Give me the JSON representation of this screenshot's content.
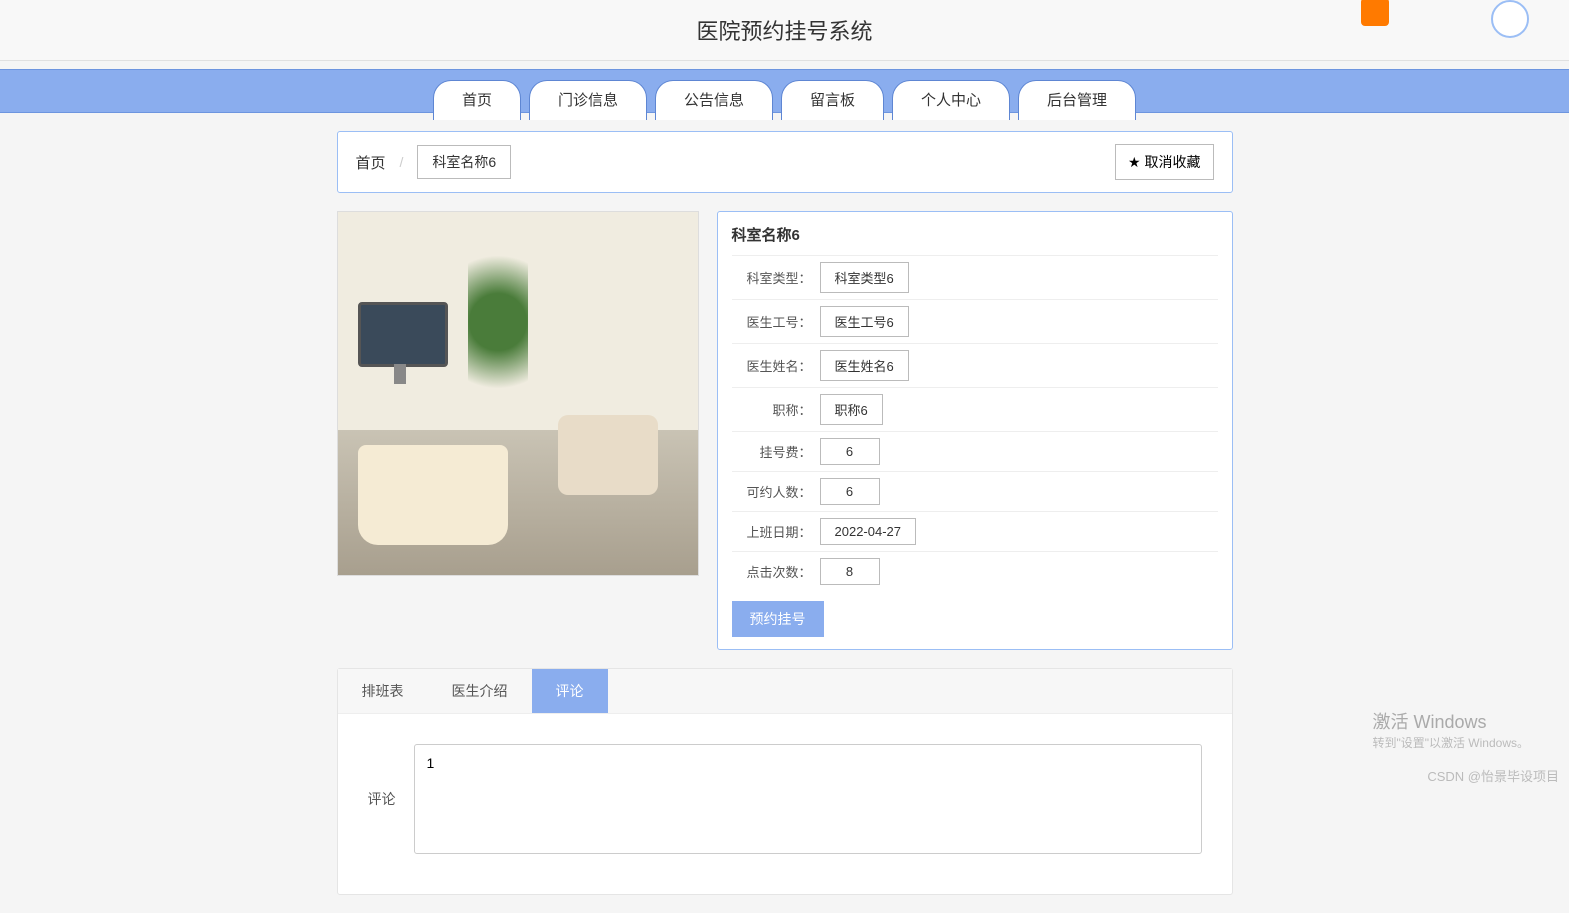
{
  "header": {
    "title": "医院预约挂号系统"
  },
  "nav": {
    "items": [
      "首页",
      "门诊信息",
      "公告信息",
      "留言板",
      "个人中心",
      "后台管理"
    ]
  },
  "breadcrumb": {
    "home": "首页",
    "separator": "/",
    "current": "科室名称6",
    "cancel_fav": "取消收藏",
    "star": "★"
  },
  "detail": {
    "title": "科室名称6",
    "rows": [
      {
        "label": "科室类型：",
        "value": "科室类型6"
      },
      {
        "label": "医生工号：",
        "value": "医生工号6"
      },
      {
        "label": "医生姓名：",
        "value": "医生姓名6"
      },
      {
        "label": "职称：",
        "value": "职称6"
      },
      {
        "label": "挂号费：",
        "value": "6"
      },
      {
        "label": "可约人数：",
        "value": "6"
      },
      {
        "label": "上班日期：",
        "value": "2022-04-27"
      },
      {
        "label": "点击次数：",
        "value": "8"
      }
    ],
    "reserve_btn": "预约挂号"
  },
  "sub_tabs": {
    "items": [
      "排班表",
      "医生介绍",
      "评论"
    ],
    "active_index": 2
  },
  "comment": {
    "label": "评论",
    "value": "1"
  },
  "watermark": {
    "win_title": "激活 Windows",
    "win_sub": "转到\"设置\"以激活 Windows。",
    "csdn": "CSDN @怡景毕设项目"
  }
}
